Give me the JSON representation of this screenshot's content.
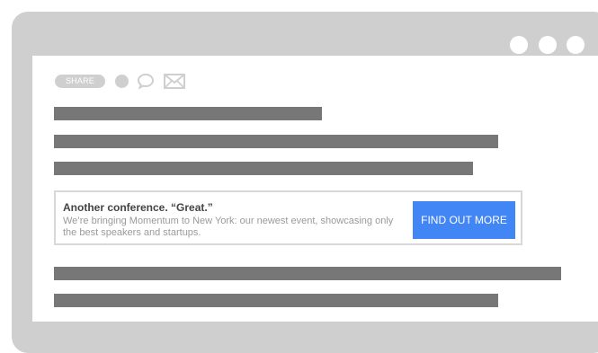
{
  "toolbar": {
    "share_label": "SHARE",
    "icons": [
      "circle-icon",
      "comment-icon",
      "mail-icon"
    ]
  },
  "promo": {
    "title": "Another conference. “Great.”",
    "description": "We’re bringing Momentum to New York: our newest event, showcasing only the best speakers and startups.",
    "button_label": "FIND OUT MORE"
  },
  "colors": {
    "window_frame": "#cfcfcf",
    "text_placeholder": "#777777",
    "accent": "#4285f4",
    "promo_border": "#d8d8d8"
  }
}
